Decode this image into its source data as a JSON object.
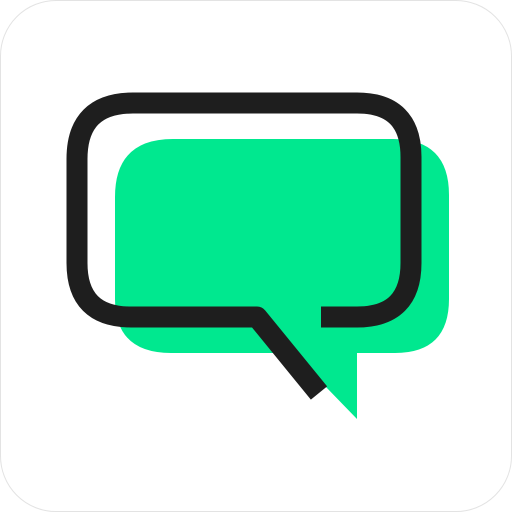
{
  "app_icon": {
    "icon": "chat-bubble-icon",
    "colors": {
      "background": "#ffffff",
      "border": "#e3e3e3",
      "bubble_fill": "#00e88f",
      "bubble_outline": "#1e1e1e"
    }
  }
}
